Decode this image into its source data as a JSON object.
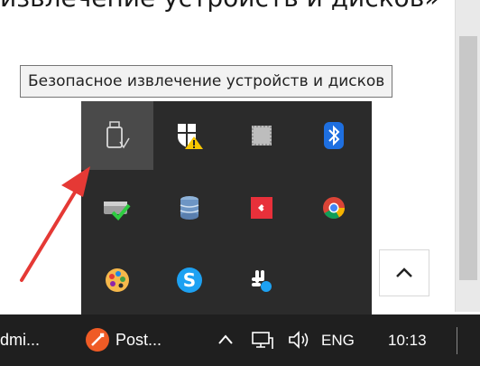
{
  "heading": {
    "text": "извлечение устройств и дисков»"
  },
  "tooltip": {
    "text": "Безопасное извлечение устройств и дисков"
  },
  "tray": {
    "items": [
      {
        "name": "usb-eject-icon"
      },
      {
        "name": "windows-security-warning-icon"
      },
      {
        "name": "grid-app-icon"
      },
      {
        "name": "bluetooth-icon"
      },
      {
        "name": "checkmark-drive-icon"
      },
      {
        "name": "database-stack-icon"
      },
      {
        "name": "anydesk-icon"
      },
      {
        "name": "chrome-icon"
      },
      {
        "name": "palette-icon"
      },
      {
        "name": "skype-icon",
        "label": "S"
      },
      {
        "name": "slack-icon"
      }
    ]
  },
  "taskbar": {
    "admin_label": "dmi...",
    "postman_label": "Post...",
    "language": "ENG",
    "time": "10:13"
  },
  "colors": {
    "tray_bg": "#2b2b2b",
    "taskbar_bg": "#1f1f1f",
    "arrow": "#e53935",
    "bluetooth": "#1e6fe0",
    "skype": "#1da1f2",
    "anydesk": "#e8303a",
    "postman": "#ef5b25"
  }
}
